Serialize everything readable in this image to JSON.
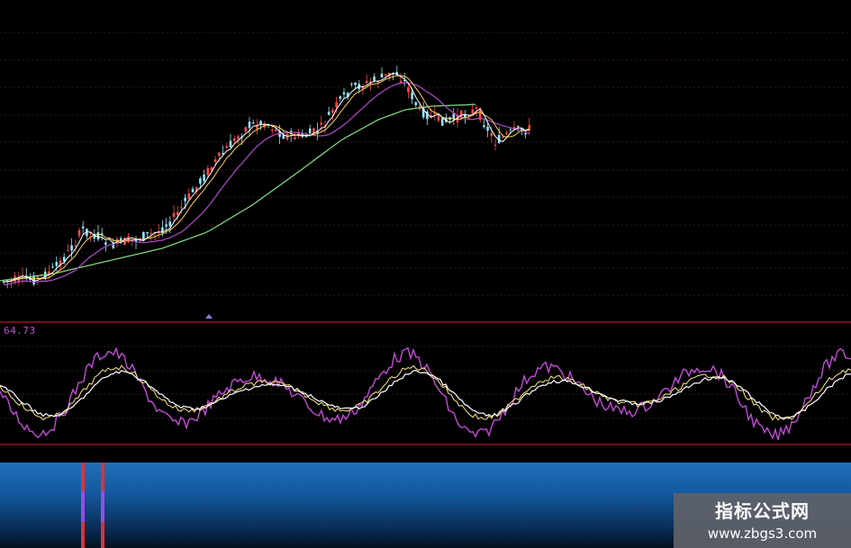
{
  "indicator": {
    "value_label": "64.73"
  },
  "watermark": {
    "title": "指标公式网",
    "url": "www.zbgs3.com"
  },
  "colors": {
    "background": "#000000",
    "candle_up": "#ff4a4a",
    "candle_down": "#8fe6ff",
    "ma_fast": "#ffffff",
    "ma_mid": "#ffd24a",
    "ma_slow": "#b04acb",
    "ma_long": "#7ed37e",
    "osc_k": "#c24bd6",
    "osc_d": "#ffffff",
    "osc_j": "#ffe880",
    "panel_border": "#b01e2a",
    "grid": "#3a1418",
    "bottom_bar": "#1464ae",
    "watermark_bg": "#5f6269"
  }
}
